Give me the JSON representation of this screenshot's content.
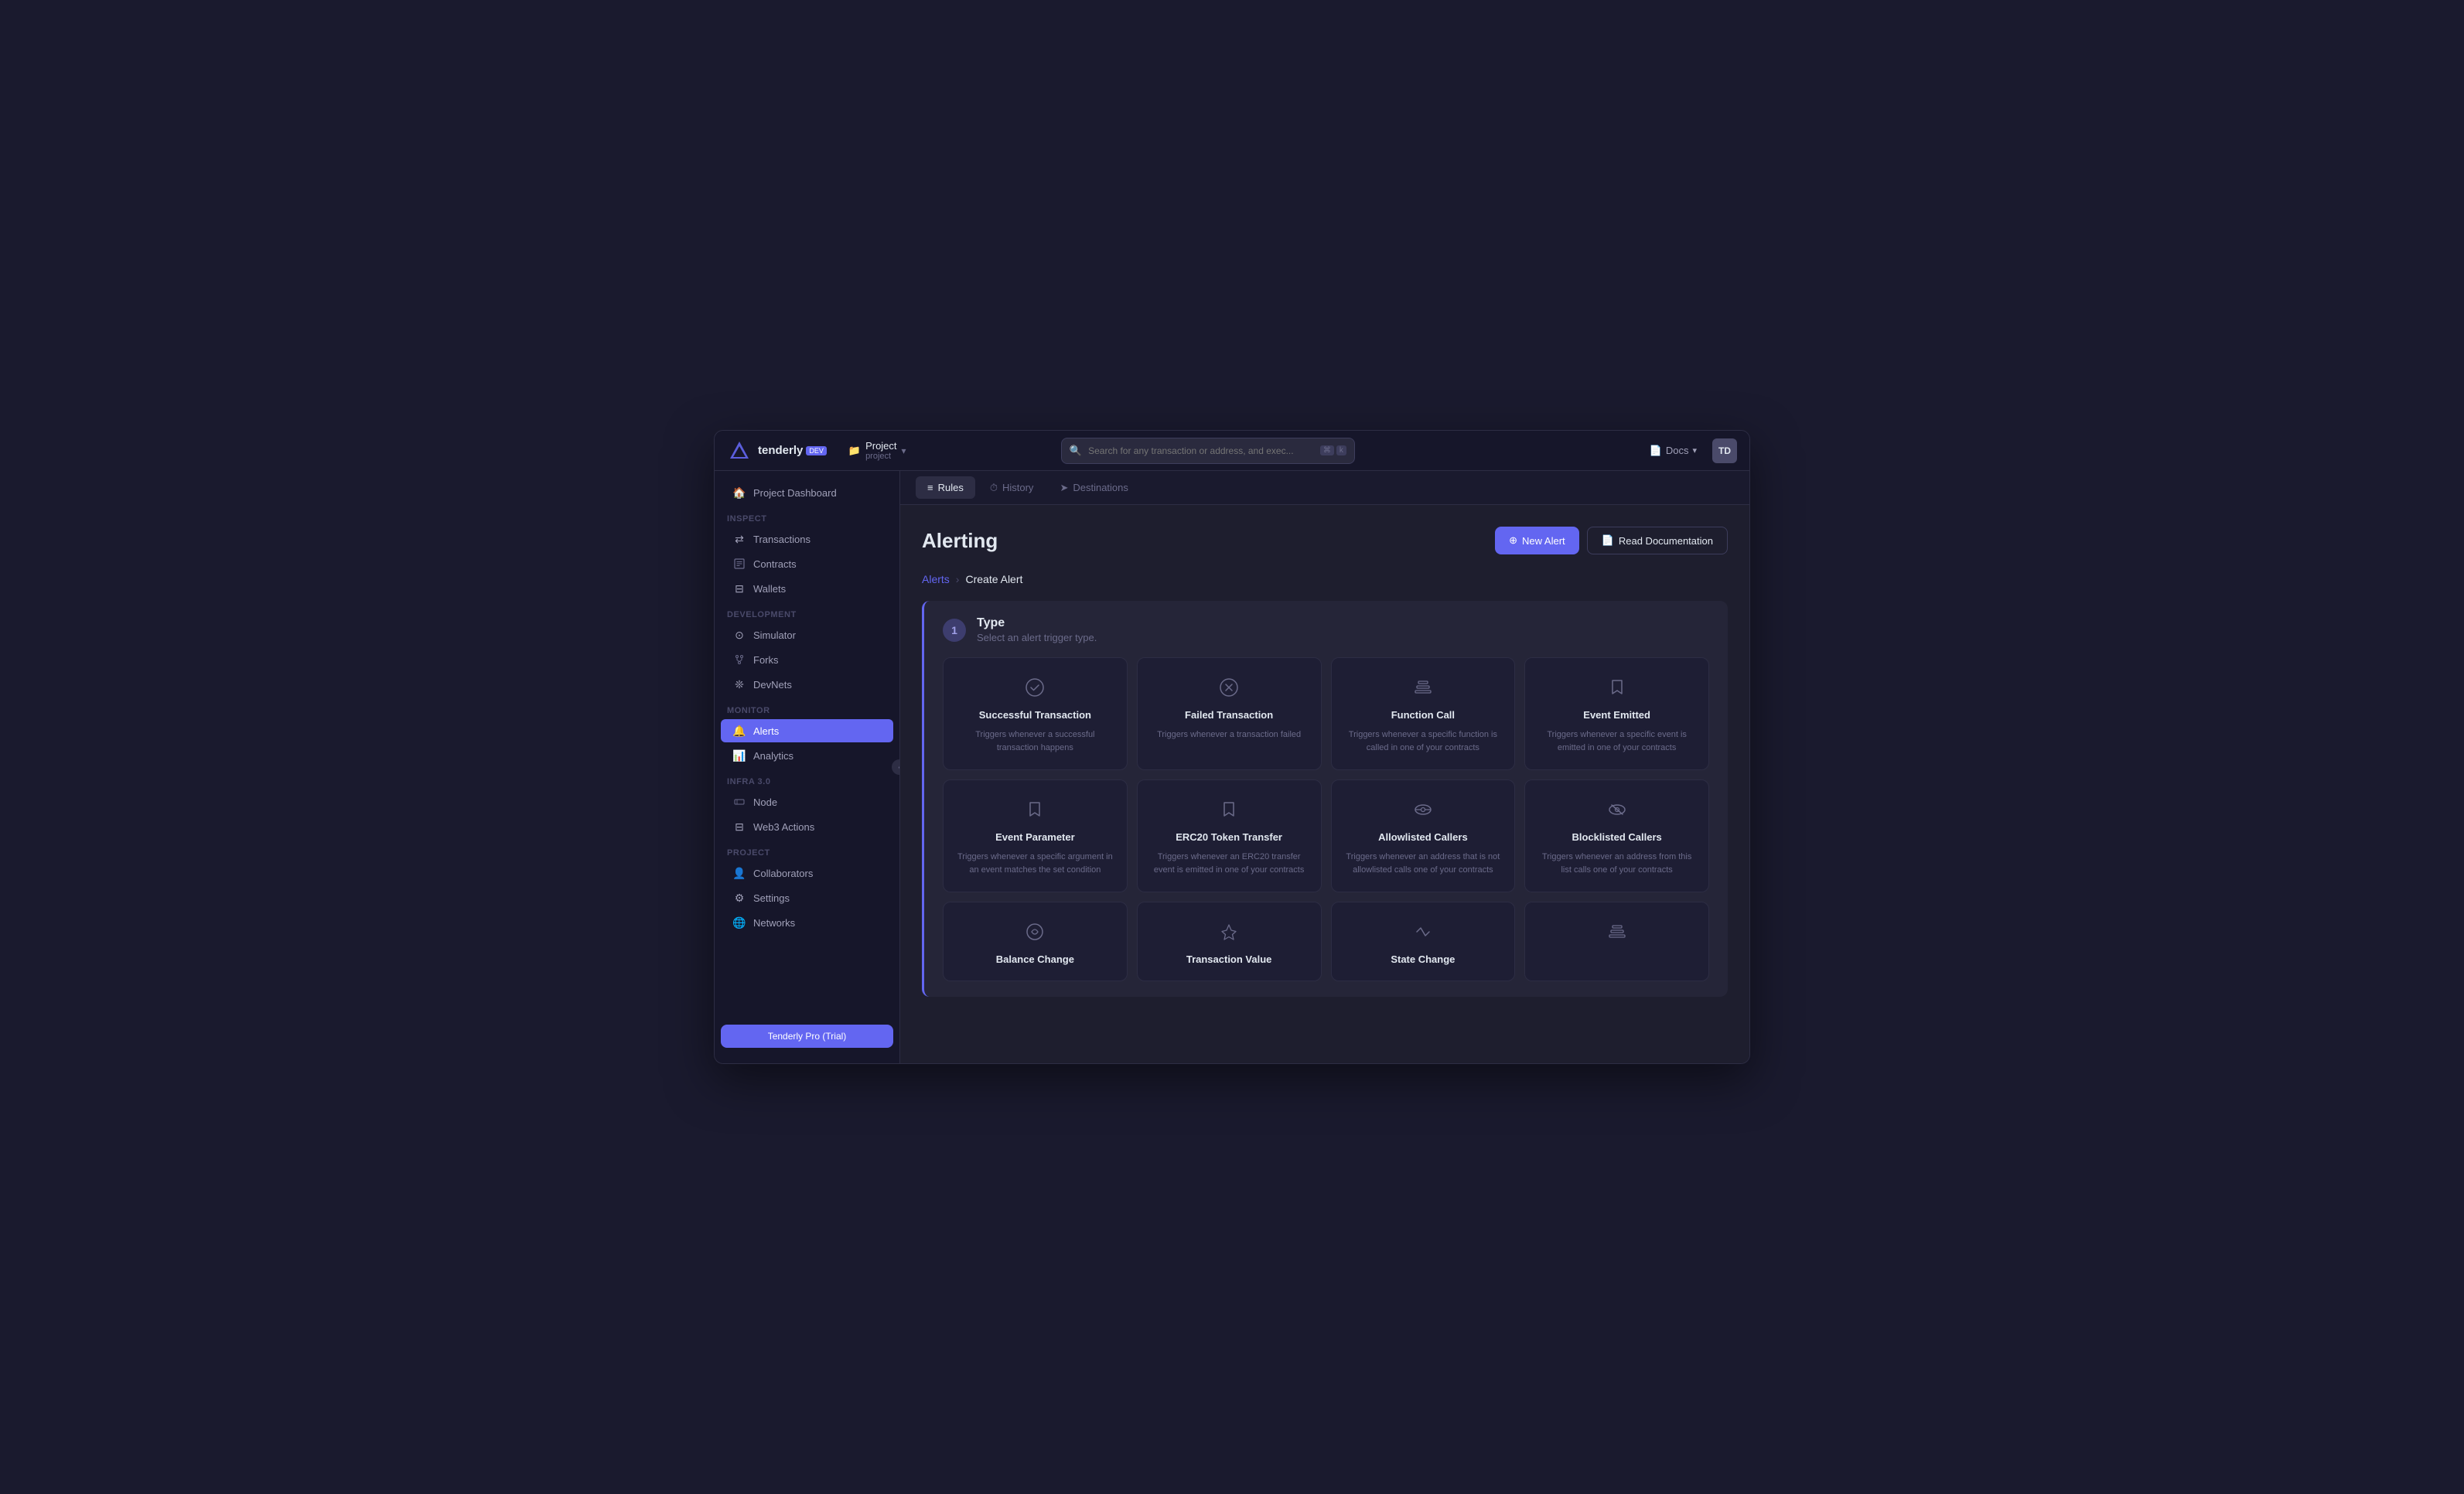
{
  "app": {
    "logo_text": "tenderly",
    "logo_badge": "DEV"
  },
  "project": {
    "icon": "📁",
    "name": "Project",
    "sub": "project",
    "chevron": "▾"
  },
  "search": {
    "placeholder": "Search for any transaction or address, and exec...",
    "shortcut_cmd": "⌘",
    "shortcut_key": "k"
  },
  "topbar": {
    "docs_label": "Docs",
    "docs_chevron": "▾",
    "avatar": "TD"
  },
  "sidebar": {
    "dashboard_label": "Project Dashboard",
    "sections": [
      {
        "label": "Inspect",
        "items": [
          {
            "id": "transactions",
            "label": "Transactions",
            "icon": "⇄"
          },
          {
            "id": "contracts",
            "label": "Contracts",
            "icon": "⊞"
          },
          {
            "id": "wallets",
            "label": "Wallets",
            "icon": "⊟"
          }
        ]
      },
      {
        "label": "Development",
        "items": [
          {
            "id": "simulator",
            "label": "Simulator",
            "icon": "⊙"
          },
          {
            "id": "forks",
            "label": "Forks",
            "icon": "⑂"
          },
          {
            "id": "devnets",
            "label": "DevNets",
            "icon": "❊"
          }
        ]
      },
      {
        "label": "Monitor",
        "items": [
          {
            "id": "alerts",
            "label": "Alerts",
            "icon": "🔔",
            "active": true
          },
          {
            "id": "analytics",
            "label": "Analytics",
            "icon": "📊"
          }
        ]
      },
      {
        "label": "Infra 3.0",
        "items": [
          {
            "id": "node",
            "label": "Node",
            "icon": "⊟"
          },
          {
            "id": "web3-actions",
            "label": "Web3 Actions",
            "icon": "⊟"
          }
        ]
      },
      {
        "label": "Project",
        "items": [
          {
            "id": "collaborators",
            "label": "Collaborators",
            "icon": "👤"
          },
          {
            "id": "settings",
            "label": "Settings",
            "icon": "⚙"
          },
          {
            "id": "networks",
            "label": "Networks",
            "icon": "🌐"
          }
        ]
      }
    ],
    "upgrade_label": "Tenderly Pro (Trial)"
  },
  "tabs": [
    {
      "id": "rules",
      "label": "Rules",
      "icon": "≡",
      "active": true
    },
    {
      "id": "history",
      "label": "History",
      "icon": "⏱"
    },
    {
      "id": "destinations",
      "label": "Destinations",
      "icon": "➤"
    }
  ],
  "page": {
    "title": "Alerting",
    "new_alert_label": "New Alert",
    "read_docs_label": "Read Documentation"
  },
  "breadcrumb": {
    "parent": "Alerts",
    "separator": "›",
    "current": "Create Alert"
  },
  "step": {
    "number": "1",
    "title": "Type",
    "description": "Select an alert trigger type."
  },
  "alert_types": [
    {
      "id": "successful-transaction",
      "title": "Successful Transaction",
      "description": "Triggers whenever a successful transaction happens",
      "icon": "✓circle"
    },
    {
      "id": "failed-transaction",
      "title": "Failed Transaction",
      "description": "Triggers whenever a transaction failed",
      "icon": "xcircle"
    },
    {
      "id": "function-call",
      "title": "Function Call",
      "description": "Triggers whenever a specific function is called in one of your contracts",
      "icon": "layers"
    },
    {
      "id": "event-emitted",
      "title": "Event Emitted",
      "description": "Triggers whenever a specific event is emitted in one of your contracts",
      "icon": "bookmark"
    },
    {
      "id": "event-parameter",
      "title": "Event Parameter",
      "description": "Triggers whenever a specific argument in an event matches the set condition",
      "icon": "bookmark"
    },
    {
      "id": "erc20-token-transfer",
      "title": "ERC20 Token Transfer",
      "description": "Triggers whenever an ERC20 transfer event is emitted in one of your contracts",
      "icon": "bookmark"
    },
    {
      "id": "allowlisted-callers",
      "title": "Allowlisted Callers",
      "description": "Triggers whenever an address that is not allowlisted calls one of your contracts",
      "icon": "eye"
    },
    {
      "id": "blocklisted-callers",
      "title": "Blocklisted Callers",
      "description": "Triggers whenever an address from this list calls one of your contracts",
      "icon": "eye-off"
    },
    {
      "id": "balance-change",
      "title": "Balance Change",
      "description": "",
      "icon": "coin"
    },
    {
      "id": "transaction-value",
      "title": "Transaction Value",
      "description": "",
      "icon": "eth"
    },
    {
      "id": "state-change",
      "title": "State Change",
      "description": "",
      "icon": "code"
    },
    {
      "id": "fourth-row-last",
      "title": "",
      "description": "",
      "icon": "layers"
    }
  ]
}
